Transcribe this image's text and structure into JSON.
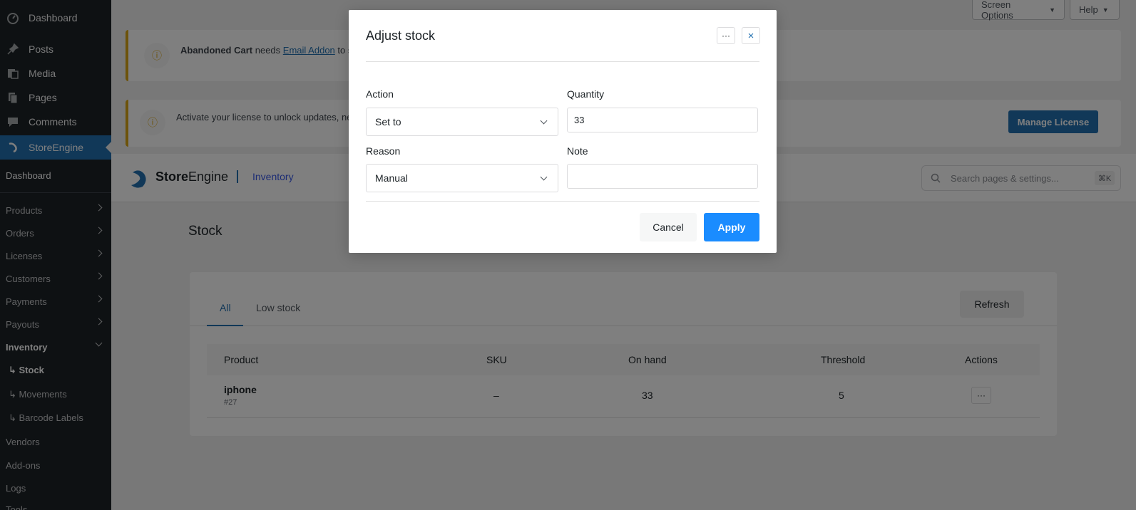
{
  "sidebar": {
    "top_items": [
      {
        "label": "Dashboard",
        "icon": "dashboard-icon"
      },
      {
        "label": "Posts",
        "icon": "pin-icon"
      },
      {
        "label": "Media",
        "icon": "media-icon"
      },
      {
        "label": "Pages",
        "icon": "pages-icon"
      },
      {
        "label": "Comments",
        "icon": "comment-icon"
      },
      {
        "label": "StoreEngine",
        "icon": "storeengine-icon"
      }
    ],
    "sub_items": {
      "dashboard": "Dashboard",
      "products": "Products",
      "orders": "Orders",
      "licenses": "Licenses",
      "customers": "Customers",
      "payments": "Payments",
      "payouts": "Payouts",
      "inventory": "Inventory",
      "stock": "↳ Stock",
      "movements": "↳ Movements",
      "barcode": "↳ Barcode Labels",
      "vendors": "Vendors",
      "addons": "Add-ons",
      "logs": "Logs",
      "tools": "Tools"
    }
  },
  "top_bar": {
    "screen_options": "Screen Options",
    "help": "Help"
  },
  "notices": {
    "abandoned_bold": "Abandoned Cart",
    "abandoned_mid": " needs ",
    "abandoned_link": "Email Addon",
    "abandoned_tail": " to s",
    "license_text": "Activate your license to unlock updates, ne",
    "manage_license": "Manage License"
  },
  "header": {
    "brand_bold": "Store",
    "brand_light": "Engine",
    "crumb": "Inventory",
    "search_placeholder": "Search pages & settings...",
    "search_kbd": "⌘K"
  },
  "page": {
    "title": "Stock",
    "tabs": [
      "All",
      "Low stock"
    ],
    "refresh": "Refresh",
    "columns": {
      "product": "Product",
      "sku": "SKU",
      "on_hand": "On hand",
      "threshold": "Threshold",
      "actions": "Actions"
    },
    "rows": [
      {
        "product": "iphone",
        "id": "#27",
        "sku": "–",
        "on_hand": "33",
        "threshold": "5",
        "actions": "···"
      }
    ]
  },
  "modal": {
    "title": "Adjust stock",
    "more_label": "···",
    "close_label": "×",
    "action_label": "Action",
    "action_value": "Set to",
    "quantity_label": "Quantity",
    "quantity_value": "33",
    "reason_label": "Reason",
    "reason_value": "Manual",
    "note_label": "Note",
    "note_value": "",
    "cancel": "Cancel",
    "apply": "Apply"
  },
  "colors": {
    "sidebar_bg": "#1d2327",
    "active_blue": "#2271b1",
    "apply_blue": "#1a8cff",
    "notice_accent": "#dba617"
  }
}
